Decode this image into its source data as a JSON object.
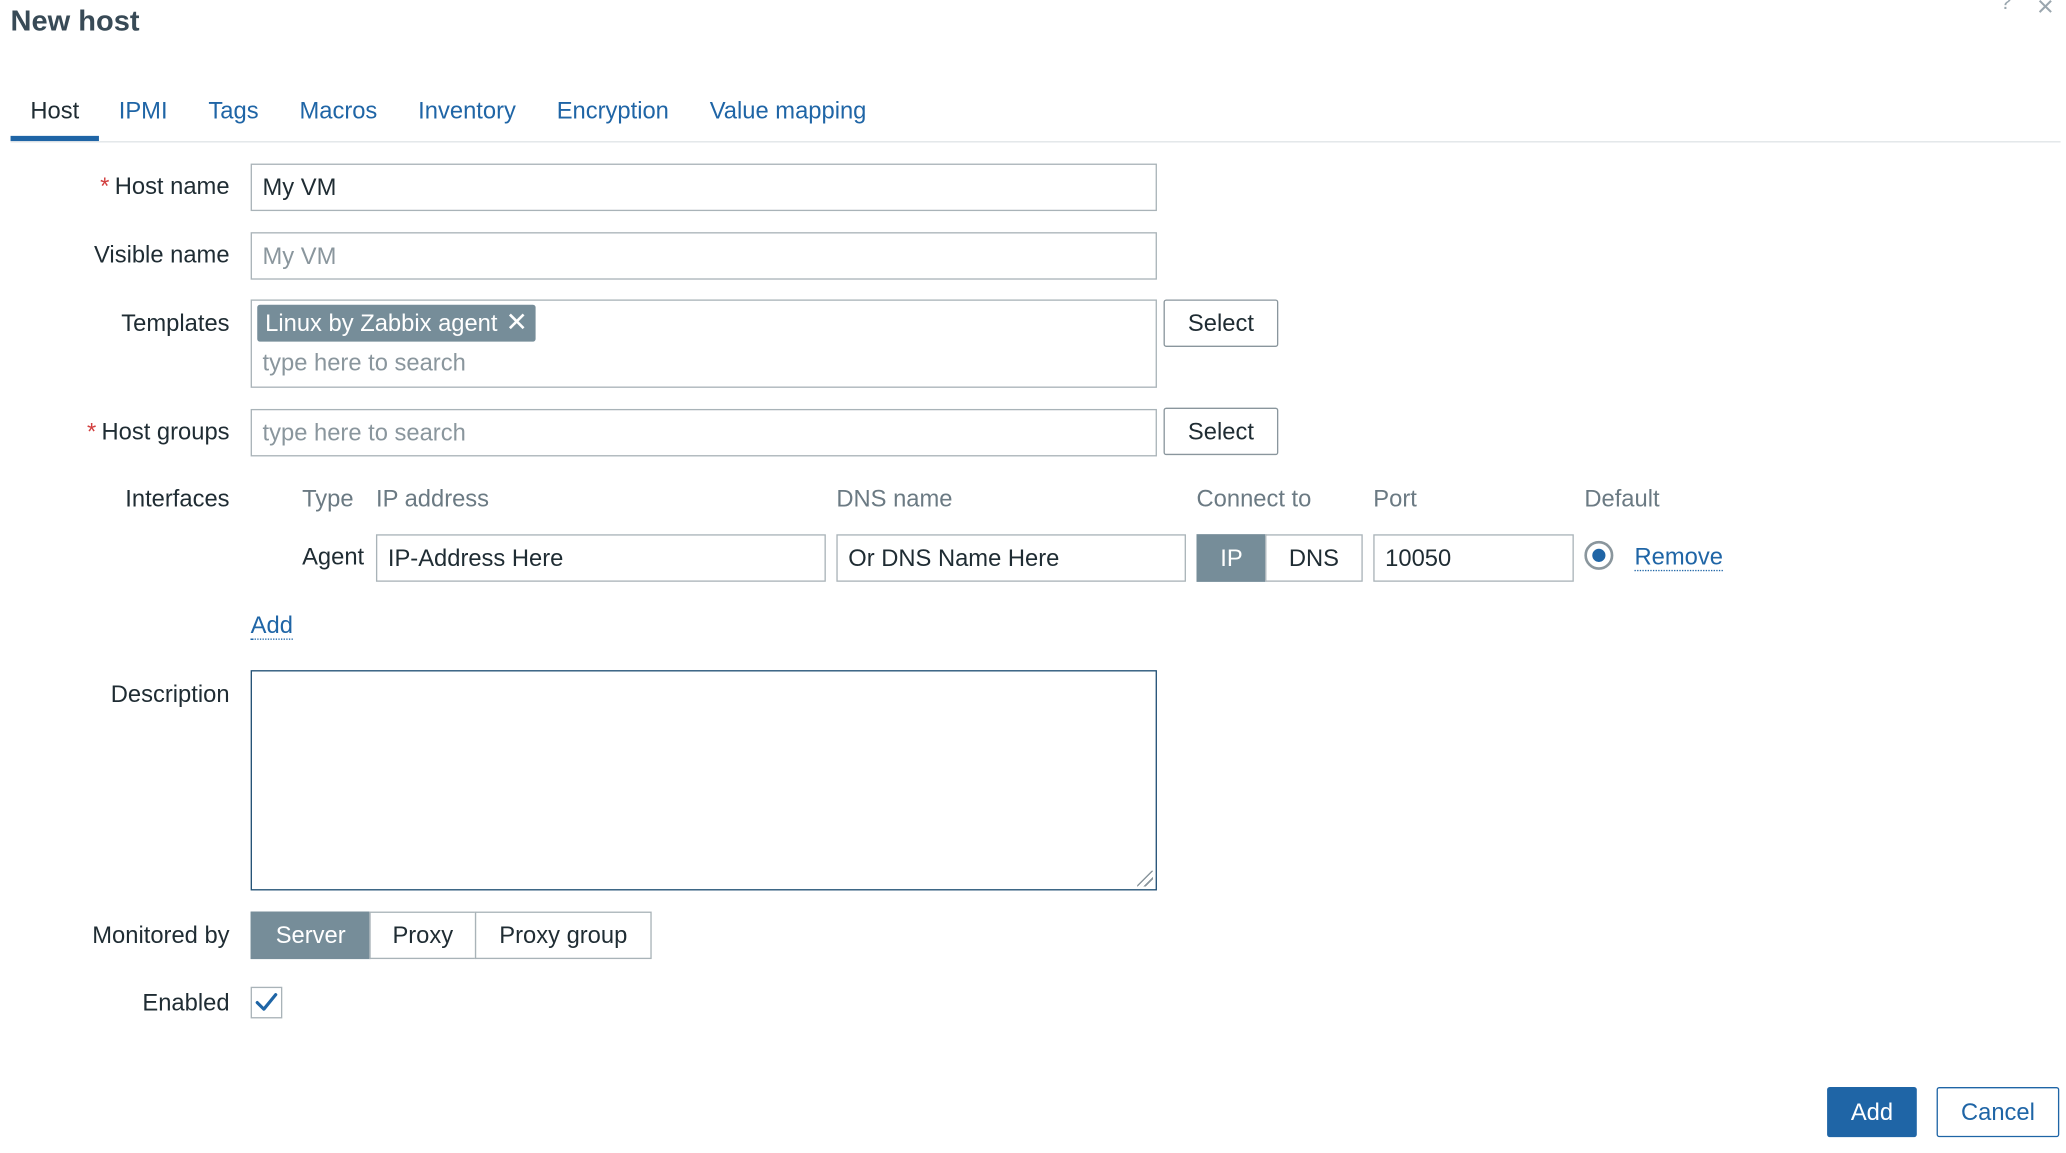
{
  "dialog": {
    "title": "New host",
    "help_icon": "?",
    "close_icon": "×"
  },
  "tabs": [
    {
      "label": "Host",
      "active": true
    },
    {
      "label": "IPMI"
    },
    {
      "label": "Tags"
    },
    {
      "label": "Macros"
    },
    {
      "label": "Inventory"
    },
    {
      "label": "Encryption"
    },
    {
      "label": "Value mapping"
    }
  ],
  "form": {
    "host_name": {
      "label": "Host name",
      "required": "*",
      "value": "My VM"
    },
    "visible_name": {
      "label": "Visible name",
      "placeholder": "My VM"
    },
    "templates": {
      "label": "Templates",
      "selected": [
        "Linux by Zabbix agent"
      ],
      "placeholder": "type here to search",
      "select_label": "Select"
    },
    "host_groups": {
      "label": "Host groups",
      "required": "*",
      "placeholder": "type here to search",
      "select_label": "Select"
    },
    "interfaces": {
      "label": "Interfaces",
      "columns": {
        "type": "Type",
        "ip": "IP address",
        "dns": "DNS name",
        "connect": "Connect to",
        "port": "Port",
        "default": "Default"
      },
      "rows": [
        {
          "type": "Agent",
          "ip": "IP-Address Here",
          "dns": "Or DNS Name Here",
          "connect_ip": "IP",
          "connect_dns": "DNS",
          "connect_selected": "IP",
          "port": "10050",
          "default": true,
          "remove_label": "Remove"
        }
      ],
      "add_label": "Add"
    },
    "description": {
      "label": "Description",
      "value": ""
    },
    "monitored_by": {
      "label": "Monitored by",
      "options": [
        "Server",
        "Proxy",
        "Proxy group"
      ],
      "selected": "Server"
    },
    "enabled": {
      "label": "Enabled",
      "checked": true,
      "check_glyph": "✓"
    }
  },
  "footer": {
    "add_label": "Add",
    "cancel_label": "Cancel"
  },
  "colors": {
    "link": "#1f65a6",
    "selected_segment": "#768d99",
    "required": "#d23f3f",
    "primary_button": "#1f65a6"
  },
  "icons": {
    "chip_remove": "close-icon",
    "checkbox": "checkmark-icon",
    "radio": "radio-selected-icon"
  },
  "chip_remove_glyph": "✕"
}
